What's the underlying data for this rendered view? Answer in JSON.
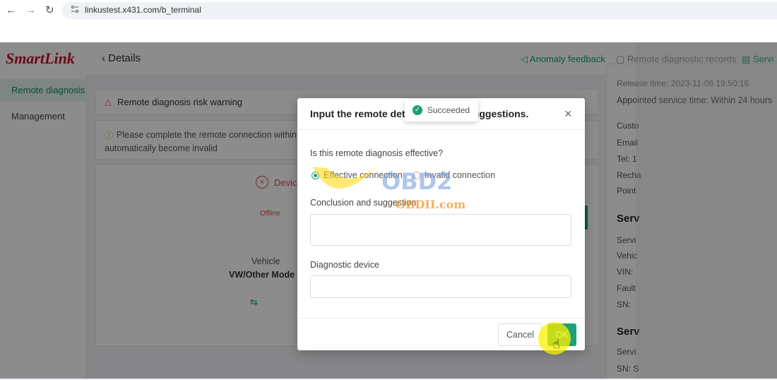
{
  "browser": {
    "url": "linkustest.x431.com/b_terminal"
  },
  "sidebar": {
    "logo": "SmartLink",
    "items": [
      {
        "label": "Remote diagnosis"
      },
      {
        "label": "Management"
      }
    ]
  },
  "topbar": {
    "back_label": "Details",
    "links": [
      {
        "label": "Anomaly feedback"
      },
      {
        "label": "Remote diagnostic records"
      },
      {
        "label": "Servi"
      }
    ]
  },
  "main": {
    "risk_warning": "Remote diagnosis risk warning",
    "connect_notice_line1": "Please complete the remote connection within",
    "connect_notice_line2": "automatically become invalid",
    "device_label": "Device",
    "status": "Offline",
    "vehicle_label": "Vehicle",
    "vehicle_model": "VW/Other Mode"
  },
  "right_panel": {
    "release_time": "Release time: 2023-11-06 19:50:16",
    "appointed": "Appointed service time: Within 24 hours",
    "fields_1": [
      "Custo",
      "Email",
      "Tel: 1",
      "Recha",
      "Point"
    ],
    "heading_1": "Serv",
    "fields_2": [
      "Servi",
      "Vehic",
      "VIN:",
      "Fault",
      "SN:"
    ],
    "heading_2": "Serv",
    "fields_3": [
      "Servi",
      "SN: S"
    ]
  },
  "modal": {
    "title": "Input the remote det",
    "title_end": "d suggestions.",
    "question": "Is this remote diagnosis effective?",
    "options": [
      "Effective connection",
      "Invalid connection"
    ],
    "selected_option": "Effective connection",
    "conclusion_label": "Conclusion and suggestion",
    "conclusion_value": "",
    "device_label": "Diagnostic device",
    "device_value": "",
    "cancel_label": "Cancel",
    "ok_label": "OK"
  },
  "toast": {
    "text": "Succeeded"
  },
  "watermark": {
    "line1": "OBD2",
    "line2": "OBDII.com"
  },
  "colors": {
    "accent": "#1aa179",
    "logo": "#c8102e",
    "danger": "#e24a4a",
    "warning": "#f0a020"
  }
}
